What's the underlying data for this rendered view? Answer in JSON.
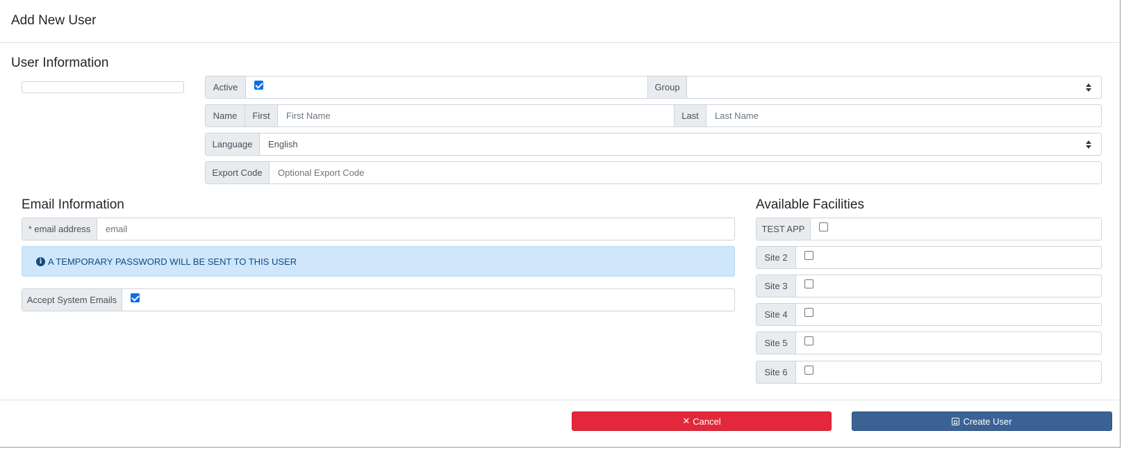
{
  "modal": {
    "title": "Add New User"
  },
  "user_info": {
    "section_title": "User Information",
    "active": {
      "label": "Active",
      "checked": true
    },
    "group": {
      "label": "Group",
      "value": ""
    },
    "name": {
      "label": "Name",
      "first_label": "First",
      "first_placeholder": "First Name",
      "last_label": "Last",
      "last_placeholder": "Last Name"
    },
    "language": {
      "label": "Language",
      "value": "English"
    },
    "export_code": {
      "label": "Export Code",
      "placeholder": "Optional Export Code"
    }
  },
  "email_info": {
    "section_title": "Email Information",
    "email": {
      "label": "* email address",
      "placeholder": "email"
    },
    "alert_text": "A TEMPORARY PASSWORD WILL BE SENT TO THIS USER",
    "accept_emails": {
      "label": "Accept System Emails",
      "checked": true
    }
  },
  "facilities": {
    "section_title": "Available Facilities",
    "items": [
      {
        "label": "TEST APP",
        "checked": false
      },
      {
        "label": "Site 2",
        "checked": false
      },
      {
        "label": "Site 3",
        "checked": false
      },
      {
        "label": "Site 4",
        "checked": false
      },
      {
        "label": "Site 5",
        "checked": false
      },
      {
        "label": "Site 6",
        "checked": false
      }
    ]
  },
  "footer": {
    "cancel_label": "Cancel",
    "create_label": "Create User"
  },
  "colors": {
    "cancel": "#e3283b",
    "create": "#3b6294",
    "alert_bg": "#cfe6fb",
    "checkbox": "#0b6ee8"
  },
  "icons": {
    "alert": "info-circle-icon",
    "cancel": "close-icon",
    "create": "save-icon"
  }
}
